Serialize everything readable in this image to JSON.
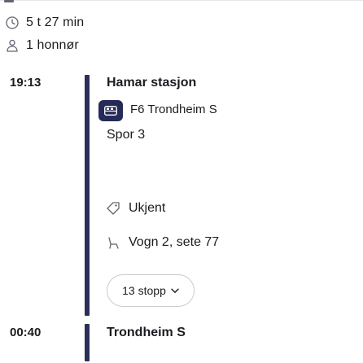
{
  "summary": {
    "duration": "5 t 27 min",
    "passengers": "1 honnør"
  },
  "legs": [
    {
      "departure_time": "19:13",
      "station": "Hamar stasjon",
      "train": "F6 Trondheim S",
      "track": "Spor 3",
      "info": "Ukjent",
      "seat": "Vogn 2, sete 77",
      "stops_button": "13 stopp"
    }
  ],
  "arrival": {
    "time": "00:40",
    "station": "Trondheim S"
  },
  "icons": {
    "duration": "clock-icon",
    "passengers": "person-icon",
    "train": "train-icon",
    "info": "tag-icon",
    "seat": "seat-icon",
    "stops_toggle": "chevron-down-icon"
  },
  "colors": {
    "rail": "#2c2f59",
    "train_badge": "#262a56"
  }
}
